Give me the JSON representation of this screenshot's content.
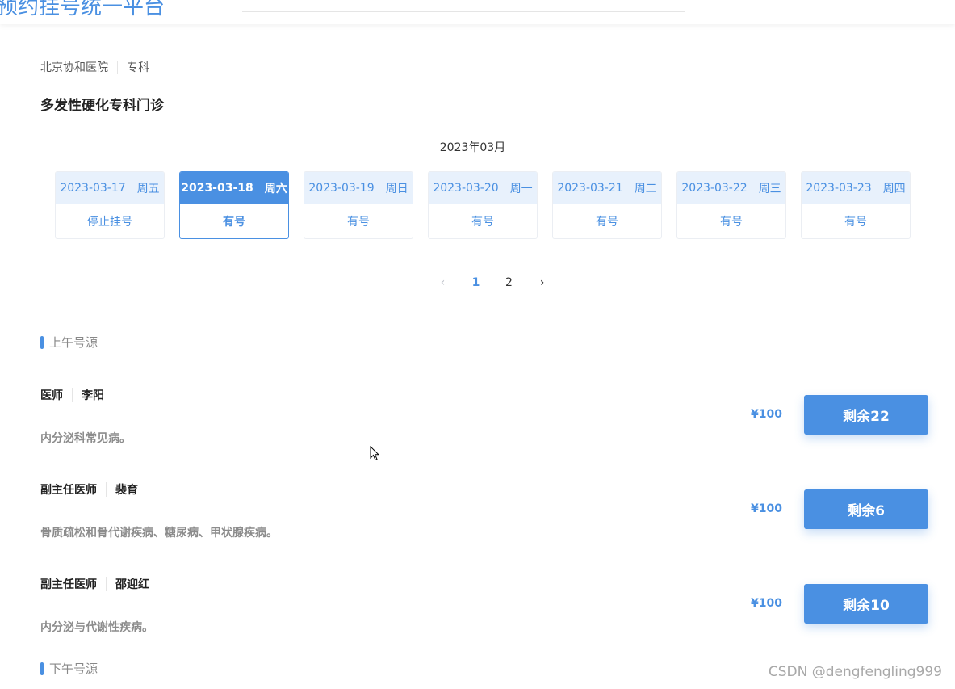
{
  "header": {
    "brand": "预约挂号统一平台"
  },
  "breadcrumb": {
    "hospital": "北京协和医院",
    "category": "专科"
  },
  "department": {
    "title": "多发性硬化专科门诊"
  },
  "calendar": {
    "month": "2023年03月",
    "days": [
      {
        "date": "2023-03-17",
        "weekday": "周五",
        "status": "停止挂号",
        "active": false
      },
      {
        "date": "2023-03-18",
        "weekday": "周六",
        "status": "有号",
        "active": true
      },
      {
        "date": "2023-03-19",
        "weekday": "周日",
        "status": "有号",
        "active": false
      },
      {
        "date": "2023-03-20",
        "weekday": "周一",
        "status": "有号",
        "active": false
      },
      {
        "date": "2023-03-21",
        "weekday": "周二",
        "status": "有号",
        "active": false
      },
      {
        "date": "2023-03-22",
        "weekday": "周三",
        "status": "有号",
        "active": false
      },
      {
        "date": "2023-03-23",
        "weekday": "周四",
        "status": "有号",
        "active": false
      }
    ],
    "pager": {
      "prev": "‹",
      "pages": [
        "1",
        "2"
      ],
      "current": "1",
      "next": "›"
    }
  },
  "morning": {
    "title": "上午号源",
    "doctors": [
      {
        "title": "医师",
        "name": "李阳",
        "desc": "内分泌科常见病。",
        "price": "¥100",
        "remain": "剩余22"
      },
      {
        "title": "副主任医师",
        "name": "裴育",
        "desc": "骨质疏松和骨代谢疾病、糖尿病、甲状腺疾病。",
        "price": "¥100",
        "remain": "剩余6"
      },
      {
        "title": "副主任医师",
        "name": "邵迎红",
        "desc": "内分泌与代谢性疾病。",
        "price": "¥100",
        "remain": "剩余10"
      }
    ]
  },
  "afternoon": {
    "title": "下午号源"
  },
  "watermark": "CSDN @dengfengling999",
  "colors": {
    "accent": "#4a90e2",
    "date_head_bg": "#e8f1fc"
  }
}
